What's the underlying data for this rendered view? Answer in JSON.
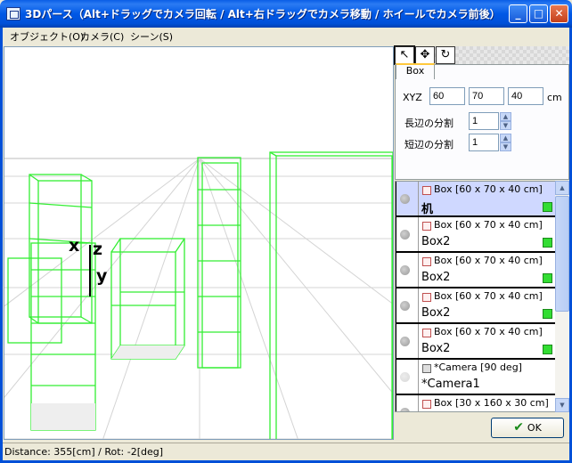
{
  "window": {
    "title": "3Dパース（Alt+ドラッグでカメラ回転 / Alt+右ドラッグでカメラ移動 / ホイールでカメラ前後）"
  },
  "menu": [
    {
      "label": "オブジェクト(O)"
    },
    {
      "label": "カメラ(C)"
    },
    {
      "label": "シーン(S)"
    }
  ],
  "viewport": {
    "axes": {
      "x": "x",
      "z": "z",
      "y": "y"
    },
    "wire_color": "#33ee33"
  },
  "tools": [
    {
      "name": "pointer-icon",
      "glyph": "↖"
    },
    {
      "name": "move-icon",
      "glyph": "✥"
    },
    {
      "name": "rotate-icon",
      "glyph": "↻"
    }
  ],
  "props": {
    "tab": "Box",
    "xyz_label": "XYZ",
    "x": "60",
    "y": "70",
    "z": "40",
    "unit": "cm",
    "long_label": "長辺の分割",
    "long_value": "1",
    "short_label": "短辺の分割",
    "short_value": "1"
  },
  "objects": [
    {
      "desc": "Box [60 x 70 x 40 cm]",
      "name": "机",
      "selected": true
    },
    {
      "desc": "Box [60 x 70 x 40 cm]",
      "name": "Box2"
    },
    {
      "desc": "Box [60 x 70 x 40 cm]",
      "name": "Box2"
    },
    {
      "desc": "Box [60 x 70 x 40 cm]",
      "name": "Box2"
    },
    {
      "desc": "Box [60 x 70 x 40 cm]",
      "name": "Box2"
    },
    {
      "desc": "*Camera [90 deg]",
      "name": "*Camera1",
      "camera": true
    },
    {
      "desc": "Box [30 x 160 x 30 cm]",
      "name": ""
    }
  ],
  "ok": "OK",
  "status": "Distance: 355[cm] / Rot: -2[deg]"
}
